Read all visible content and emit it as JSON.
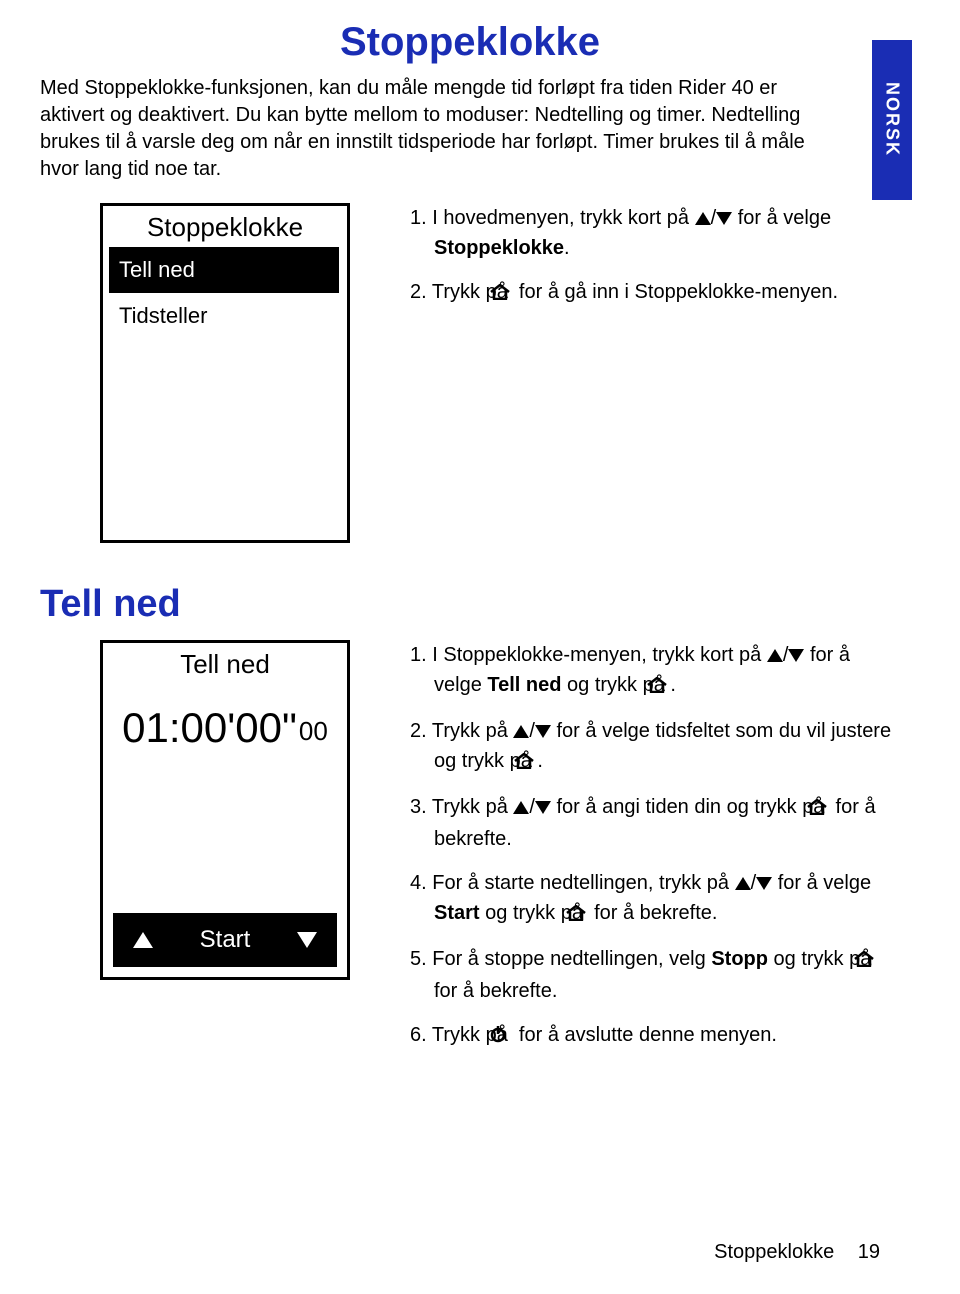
{
  "title": "Stoppeklokke",
  "intro": "Med Stoppeklokke-funksjonen, kan du måle mengde tid forløpt fra tiden Rider 40 er aktivert og deaktivert. Du kan bytte mellom to moduser: Nedtelling og timer. Nedtelling brukes til å varsle deg om når en innstilt tidsperiode har forløpt. Timer brukes til å måle hvor lang tid noe tar.",
  "side_tab": "NORSK",
  "screen1": {
    "header": "Stoppeklokke",
    "item_selected": "Tell ned",
    "item2": "Tidsteller"
  },
  "steps_top": {
    "s1a": "1. I hovedmenyen, trykk kort på ",
    "s1b": " for å velge ",
    "s1c": "Stoppeklokke",
    "s1d": ".",
    "s2a": "2. Trykk på ",
    "s2b": " for å gå inn i Stoppeklokke-menyen."
  },
  "section2_title": "Tell ned",
  "screen2": {
    "header": "Tell ned",
    "time_big": "01:00'00\"",
    "time_small": "00",
    "start": "Start"
  },
  "steps_bottom": {
    "s1a": "1. I Stoppeklokke-menyen, trykk kort på ",
    "s1b": " for å velge ",
    "s1c": "Tell ned",
    "s1d": " og trykk på ",
    "s1e": ".",
    "s2a": "2. Trykk på ",
    "s2b": " for å velge tidsfeltet som du vil justere og trykk på ",
    "s2c": ".",
    "s3a": "3. Trykk på ",
    "s3b": " for å angi tiden din og trykk på ",
    "s3c": " for å bekrefte.",
    "s4a": "4. For å starte nedtellingen, trykk på ",
    "s4b": " for å velge ",
    "s4c": "Start",
    "s4d": " og trykk på ",
    "s4e": " for å bekrefte.",
    "s5a": "5. For å stoppe nedtellingen, velg ",
    "s5b": "Stopp",
    "s5c": " og trykk på ",
    "s5d": " for å bekrefte.",
    "s6a": "6. Trykk på ",
    "s6b": " for å avslutte denne menyen."
  },
  "footer": {
    "name": "Stoppeklokke",
    "page": "19"
  }
}
